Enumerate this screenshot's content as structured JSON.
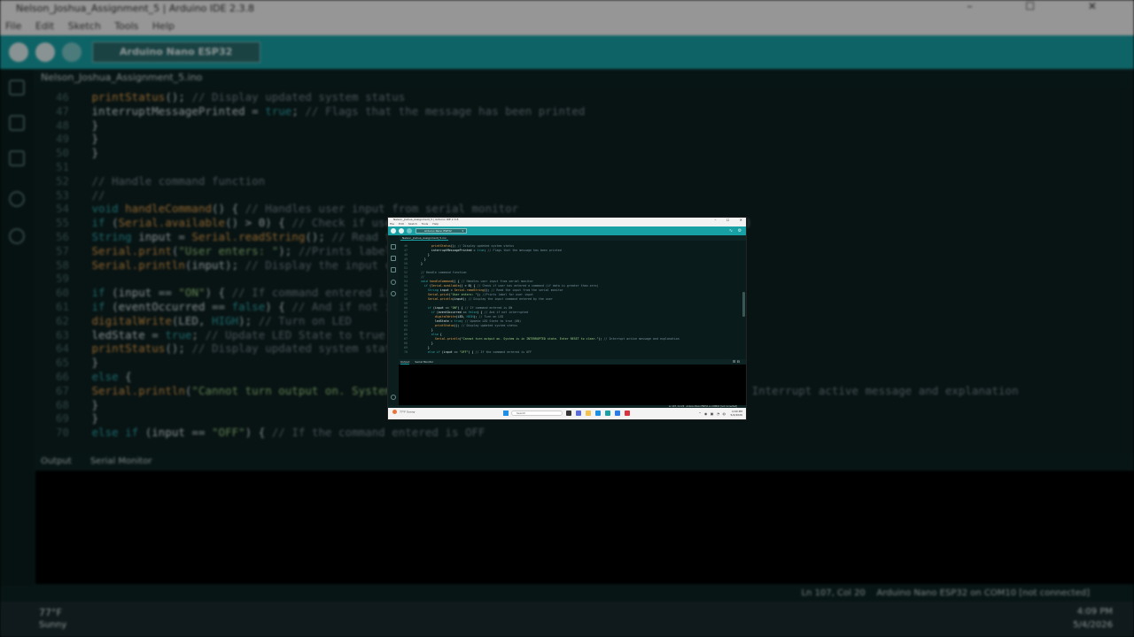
{
  "window": {
    "title": "Nelson_Joshua_Assignment_5 | Arduino IDE 2.3.8",
    "controls": [
      "–",
      "☐",
      "✕"
    ]
  },
  "menu": [
    "File",
    "Edit",
    "Sketch",
    "Tools",
    "Help"
  ],
  "toolbar": {
    "board": "Arduino Nano ESP32",
    "verify_icon": "check-icon",
    "upload_icon": "arrow-right-icon",
    "debug_icon": "debug-icon",
    "plotter_icon": "serial-plotter-icon",
    "monitor_icon": "serial-monitor-icon"
  },
  "tab": {
    "filename": "Nelson_Joshua_Assignment_5.ino"
  },
  "sidebar": [
    "sketchbook-icon",
    "boards-manager-icon",
    "library-manager-icon",
    "debug-icon",
    "search-icon"
  ],
  "code_lines": [
    [
      {
        "t": "          "
      },
      {
        "c": "fn",
        "t": "printStatus"
      },
      {
        "t": "(); "
      },
      {
        "c": "cm",
        "t": "// Display updated system status"
      }
    ],
    [
      {
        "t": "          interruptMessagePrinted = "
      },
      {
        "c": "kw",
        "t": "true"
      },
      {
        "t": "; "
      },
      {
        "c": "cm",
        "t": "// Flags that the message has been printed"
      }
    ],
    [
      {
        "t": "        }"
      }
    ],
    [
      {
        "t": "      }"
      }
    ],
    [
      {
        "t": "    }"
      }
    ],
    [
      {
        "t": ""
      }
    ],
    [
      {
        "c": "cm",
        "t": "    // Handle command function"
      }
    ],
    [
      {
        "c": "cm",
        "t": "    //"
      }
    ],
    [
      {
        "c": "kw",
        "t": "    void "
      },
      {
        "c": "fn",
        "t": "handleCommand"
      },
      {
        "t": "() { "
      },
      {
        "c": "cm",
        "t": "// Handles user input from serial monitor"
      }
    ],
    [
      {
        "t": "      "
      },
      {
        "c": "kw",
        "t": "if"
      },
      {
        "t": " ("
      },
      {
        "c": "fn",
        "t": "Serial.available"
      },
      {
        "t": "() > 0) { "
      },
      {
        "c": "cm",
        "t": "// Check if user has entered a command (if data is greater than zero)"
      }
    ],
    [
      {
        "t": "        "
      },
      {
        "c": "kw",
        "t": "String"
      },
      {
        "t": " input = "
      },
      {
        "c": "fn",
        "t": "Serial.readString"
      },
      {
        "t": "(); "
      },
      {
        "c": "cm",
        "t": "// Read the input from the serial monitor"
      }
    ],
    [
      {
        "t": "        "
      },
      {
        "c": "fn",
        "t": "Serial.print"
      },
      {
        "t": "("
      },
      {
        "c": "st",
        "t": "\"User enters: \""
      },
      {
        "t": "); "
      },
      {
        "c": "cm",
        "t": "//Prints label for user input"
      }
    ],
    [
      {
        "t": "        "
      },
      {
        "c": "fn",
        "t": "Serial.println"
      },
      {
        "t": "(input); "
      },
      {
        "c": "cm",
        "t": "// Display the input command entered by the user"
      }
    ],
    [
      {
        "t": ""
      }
    ],
    [
      {
        "t": "        "
      },
      {
        "c": "kw",
        "t": "if"
      },
      {
        "t": " (input == "
      },
      {
        "c": "st",
        "t": "\"ON\""
      },
      {
        "t": ") { "
      },
      {
        "c": "cm",
        "t": "// If command entered is ON"
      }
    ],
    [
      {
        "t": "          "
      },
      {
        "c": "kw",
        "t": "if"
      },
      {
        "t": " (eventOccurred == "
      },
      {
        "c": "kw",
        "t": "false"
      },
      {
        "t": ") { "
      },
      {
        "c": "cm",
        "t": "// And if not interrupted"
      }
    ],
    [
      {
        "t": "            "
      },
      {
        "c": "fn",
        "t": "digitalWrite"
      },
      {
        "t": "(LED, "
      },
      {
        "c": "kw",
        "t": "HIGH"
      },
      {
        "t": "); "
      },
      {
        "c": "cm",
        "t": "// Turn on LED"
      }
    ],
    [
      {
        "t": "            ledState = "
      },
      {
        "c": "kw",
        "t": "true"
      },
      {
        "t": "; "
      },
      {
        "c": "cm",
        "t": "// Update LED State to true (ON)"
      }
    ],
    [
      {
        "t": "            "
      },
      {
        "c": "fn",
        "t": "printStatus"
      },
      {
        "t": "(); "
      },
      {
        "c": "cm",
        "t": "// Display updated system status"
      }
    ],
    [
      {
        "t": "          }"
      }
    ],
    [
      {
        "t": "          "
      },
      {
        "c": "kw",
        "t": "else"
      },
      {
        "t": " {"
      }
    ],
    [
      {
        "t": "            "
      },
      {
        "c": "fn",
        "t": "Serial.println"
      },
      {
        "t": "("
      },
      {
        "c": "st",
        "t": "\"Cannot turn output on. System is in INTERRUPTED state. Enter RESET to clear.\""
      },
      {
        "t": "); "
      },
      {
        "c": "cm",
        "t": "// Interrupt active message and explanation"
      }
    ],
    [
      {
        "t": "          }"
      }
    ],
    [
      {
        "t": "        }"
      }
    ],
    [
      {
        "t": "        "
      },
      {
        "c": "kw",
        "t": "else if"
      },
      {
        "t": " (input == "
      },
      {
        "c": "st",
        "t": "\"OFF\""
      },
      {
        "t": ") { "
      },
      {
        "c": "cm",
        "t": "// If the command entered is OFF"
      }
    ]
  ],
  "line_numbers": [
    "46",
    "47",
    "48",
    "49",
    "50",
    "51",
    "52",
    "53",
    "54",
    "55",
    "56",
    "57",
    "58",
    "59",
    "60",
    "61",
    "62",
    "63",
    "64",
    "65",
    "66",
    "67",
    "68",
    "69",
    "70"
  ],
  "output_tabs": {
    "output": "Output",
    "serial_monitor": "Serial Monitor"
  },
  "status": {
    "cursor": "Ln 107, Col 20",
    "board": "Arduino Nano ESP32 on COM10 [not connected]"
  },
  "taskbar": {
    "weather_temp": "77°F",
    "weather_desc": "Sunny",
    "search_placeholder": "Search",
    "time": "4:09 PM",
    "date": "5/4/2026"
  },
  "colors": {
    "toolbar": "#17a1a5",
    "editor_bg": "#0a1b1b",
    "keyword": "#2fa8ad",
    "function": "#e5a14c",
    "comment": "#75909a",
    "string": "#9bcf82"
  }
}
